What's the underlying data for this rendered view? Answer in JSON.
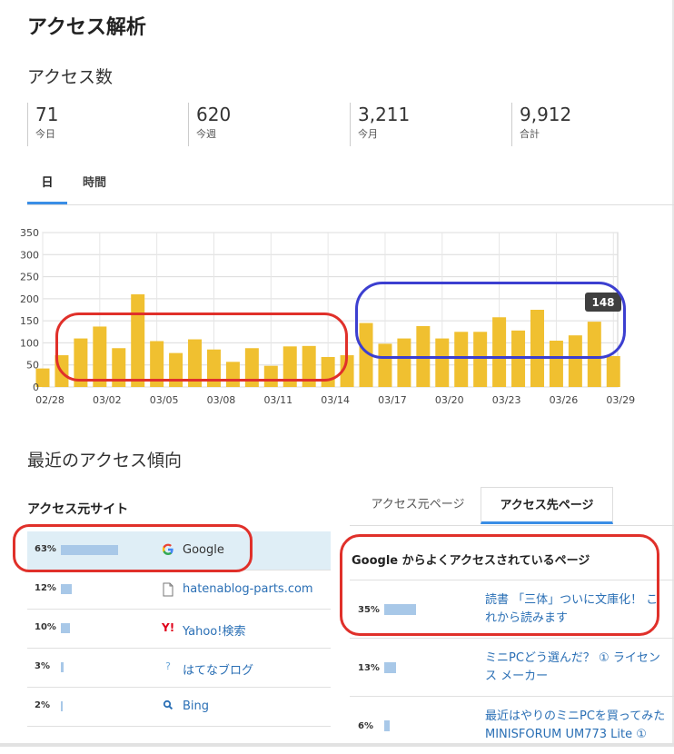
{
  "header": {
    "title": "アクセス解析"
  },
  "access_count": {
    "title": "アクセス数",
    "stats": [
      {
        "value": "71",
        "label": "今日"
      },
      {
        "value": "620",
        "label": "今週"
      },
      {
        "value": "3,211",
        "label": "今月"
      },
      {
        "value": "9,912",
        "label": "合計"
      }
    ]
  },
  "tabs": {
    "day": "日",
    "hour": "時間",
    "active": "day"
  },
  "chart_data": {
    "type": "bar",
    "categories": [
      "02/28",
      "03/01",
      "03/02",
      "03/03",
      "03/04",
      "03/05",
      "03/06",
      "03/07",
      "03/08",
      "03/09",
      "03/10",
      "03/11",
      "03/12",
      "03/13",
      "03/14",
      "03/15",
      "03/16",
      "03/17",
      "03/18",
      "03/19",
      "03/20",
      "03/21",
      "03/22",
      "03/23",
      "03/24",
      "03/25",
      "03/26",
      "03/27",
      "03/28",
      "03/29"
    ],
    "values": [
      42,
      72,
      110,
      137,
      88,
      210,
      104,
      77,
      108,
      85,
      57,
      88,
      48,
      92,
      93,
      68,
      72,
      145,
      98,
      110,
      138,
      110,
      125,
      125,
      158,
      128,
      175,
      105,
      117,
      148,
      70
    ],
    "x_tick_labels": [
      "02/28",
      "03/02",
      "03/05",
      "03/08",
      "03/11",
      "03/14",
      "03/17",
      "03/20",
      "03/23",
      "03/26",
      "03/29"
    ],
    "y_ticks": [
      0,
      50,
      100,
      150,
      200,
      250,
      300,
      350
    ],
    "ylim": [
      0,
      350
    ],
    "grid": true,
    "bar_color": "#f0c030",
    "tooltip": {
      "value": "148"
    }
  },
  "trend": {
    "title": "最近のアクセス傾向"
  },
  "sources": {
    "title": "アクセス元サイト",
    "items": [
      {
        "pct": "63%",
        "fraction": 0.63,
        "icon": "google-icon",
        "name": "Google"
      },
      {
        "pct": "12%",
        "fraction": 0.12,
        "icon": "document-icon",
        "name": "hatenablog-parts.com"
      },
      {
        "pct": "10%",
        "fraction": 0.1,
        "icon": "yahoo-icon",
        "name": "Yahoo!検索"
      },
      {
        "pct": "3%",
        "fraction": 0.03,
        "icon": "hatena-icon",
        "name": "はてなブログ"
      },
      {
        "pct": "2%",
        "fraction": 0.02,
        "icon": "bing-search-icon",
        "name": "Bing"
      }
    ]
  },
  "page_tabs": {
    "source_page": "アクセス元ページ",
    "dest_page": "アクセス先ページ",
    "active": "dest_page"
  },
  "destinations": {
    "title": "Google からよくアクセスされているページ",
    "items": [
      {
        "pct": "35%",
        "fraction": 0.35,
        "title": "読書 「三体」ついに文庫化！ これから読みます"
      },
      {
        "pct": "13%",
        "fraction": 0.13,
        "title": "ミニPCどう選んだ？ ① ライセンス メーカー"
      },
      {
        "pct": "6%",
        "fraction": 0.06,
        "title": "最近はやりのミニPCを買ってみた MINISFORUM UM773 Lite ①"
      }
    ]
  },
  "colors": {
    "accent": "#3a8ee6",
    "annotation_red": "#e0302a",
    "annotation_blue": "#3c3fd0",
    "bar": "#f0c030"
  }
}
